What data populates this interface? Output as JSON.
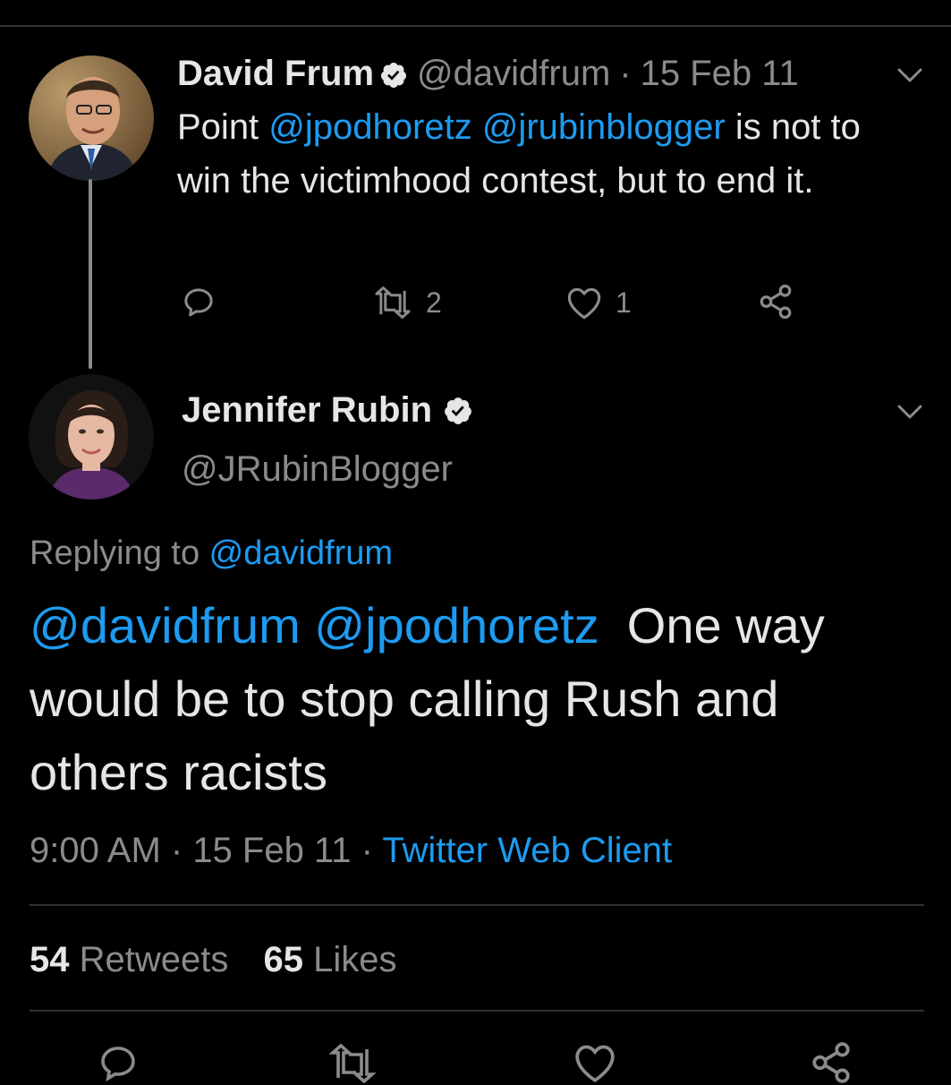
{
  "tweet1": {
    "name": "David Frum",
    "handle": "@davidfrum",
    "separator": "·",
    "date": "15 Feb 11",
    "text_pre": "Point ",
    "mention1": "@jpodhoretz",
    "mention2": "@jrubinblogger",
    "text_post": " is not to win the victimhood contest, but to end it.",
    "retweet_count": "2",
    "like_count": "1"
  },
  "tweet2": {
    "name": "Jennifer Rubin",
    "handle": "@JRubinBlogger",
    "replying_label": "Replying to ",
    "replying_handle": "@davidfrum",
    "mention1": "@davidfrum",
    "mention2": "@jpodhoretz",
    "text": "  One way would be to stop calling Rush and others racists",
    "time": "9:00 AM",
    "separator": " · ",
    "date": "15 Feb 11",
    "client": "Twitter Web Client",
    "retweets_count": "54",
    "retweets_label": "Retweets",
    "likes_count": "65",
    "likes_label": "Likes"
  },
  "colors": {
    "background": "#000000",
    "link": "#1d9bf0",
    "muted": "#8b8b8b",
    "text": "#e6e6e6"
  },
  "icons": {
    "verified": "verified-badge-icon",
    "reply": "reply-icon",
    "retweet": "retweet-icon",
    "like": "heart-icon",
    "share": "share-icon",
    "menu": "chevron-down-icon"
  }
}
